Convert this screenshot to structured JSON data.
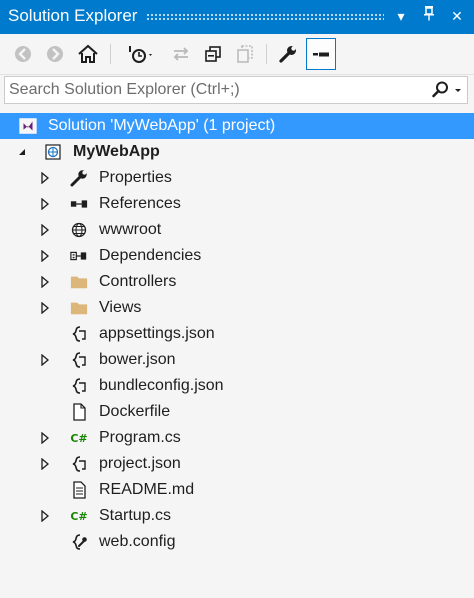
{
  "window": {
    "title": "Solution Explorer",
    "dropdown_glyph": "▾",
    "pin_glyph": "ꟷ",
    "close_glyph": "✕"
  },
  "search": {
    "placeholder": "Search Solution Explorer (Ctrl+;)"
  },
  "tree": {
    "solution_label": "Solution 'MyWebApp' (1 project)",
    "project_label": "MyWebApp",
    "items": [
      {
        "label": "Properties",
        "icon": "wrench-icon"
      },
      {
        "label": "References",
        "icon": "references-icon"
      },
      {
        "label": "wwwroot",
        "icon": "globe-icon"
      },
      {
        "label": "Dependencies",
        "icon": "dependencies-icon"
      },
      {
        "label": "Controllers",
        "icon": "folder-icon"
      },
      {
        "label": "Views",
        "icon": "folder-icon"
      },
      {
        "label": "appsettings.json",
        "icon": "json-file-icon"
      },
      {
        "label": "bower.json",
        "icon": "json-file-icon"
      },
      {
        "label": "bundleconfig.json",
        "icon": "json-file-icon"
      },
      {
        "label": "Dockerfile",
        "icon": "file-icon"
      },
      {
        "label": "Program.cs",
        "icon": "csharp-file-icon"
      },
      {
        "label": "project.json",
        "icon": "json-file-icon"
      },
      {
        "label": "README.md",
        "icon": "text-file-icon"
      },
      {
        "label": "Startup.cs",
        "icon": "csharp-file-icon"
      },
      {
        "label": "web.config",
        "icon": "config-file-icon"
      }
    ],
    "csharp_badge": "C#"
  },
  "colors": {
    "title_bar": "#007acc",
    "selection": "#3399ff",
    "folder": "#dcb67a",
    "csharp": "#178600"
  }
}
